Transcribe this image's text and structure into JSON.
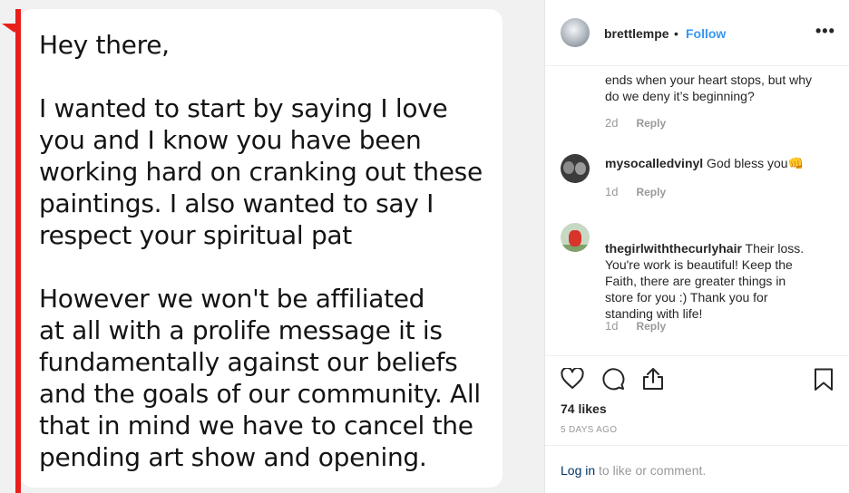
{
  "message": {
    "text": "Hey there,\n\nI wanted to start by saying I love\nyou and I know you have been\nworking hard on cranking out these\npaintings. I also wanted to say I\nrespect your spiritual pat\n\nHowever we won't  be affiliated\nat all with a prolife message it is\nfundamentally against our beliefs\nand the goals of our community. All\nthat in mind we have to cancel the\npending art show and opening."
  },
  "header": {
    "username": "brettlempe",
    "separator": "•",
    "follow_label": "Follow",
    "more_label": "•••"
  },
  "comments": [
    {
      "user": "",
      "text": "ends when your heart stops, but why\ndo we deny it’s beginning?",
      "age": "2d",
      "reply_label": "Reply"
    },
    {
      "user": "mysocalledvinyl",
      "text": " God bless you👊",
      "age": "1d",
      "reply_label": "Reply"
    },
    {
      "user": "thegirlwiththecurlyhair",
      "text": " Their loss.\nYou're work is beautiful! Keep the\nFaith, there are greater things in\nstore for you :) Thank you for\nstanding with life!",
      "age": "1d",
      "reply_label": "Reply"
    }
  ],
  "actions": {
    "icons": [
      "heart-icon",
      "comment-icon",
      "share-icon",
      "bookmark-icon"
    ],
    "likes": "74 likes",
    "posted_ago": "5 DAYS AGO"
  },
  "login": {
    "link_label": "Log in",
    "rest_text": "to like or comment."
  },
  "colors": {
    "accent": "#3897f0",
    "message_bar": "#e8201c",
    "muted": "#999999"
  }
}
